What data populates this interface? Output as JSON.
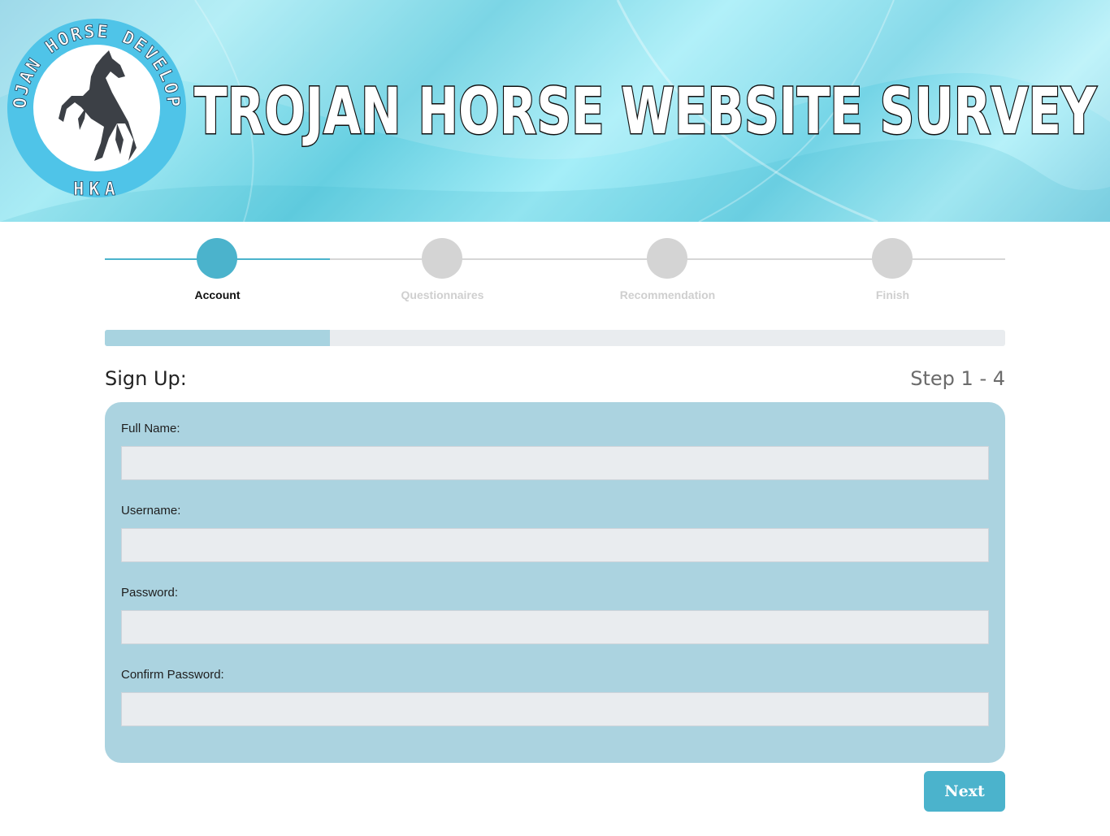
{
  "banner": {
    "title": "TROJAN HORSE WEBSITE SURVEY",
    "logo": {
      "ring_text": "TROJAN HORSE DEVELOPER",
      "bottom_text": "HKA",
      "icon": "rearing-horse-icon"
    }
  },
  "stepper": {
    "steps": [
      {
        "label": "Account",
        "icon": "user-icon",
        "glyph": "",
        "active": true
      },
      {
        "label": "Questionnaires",
        "icon": "list-icon",
        "glyph": "",
        "active": false
      },
      {
        "label": "Recommendation",
        "icon": "star-icon",
        "glyph": "",
        "active": false
      },
      {
        "label": "Finish",
        "icon": "check-icon",
        "glyph": "",
        "active": false
      }
    ]
  },
  "progress": {
    "percent": 25
  },
  "form": {
    "heading": "Sign Up:",
    "step_count": "Step 1 - 4",
    "fields": [
      {
        "label": "Full Name:",
        "value": ""
      },
      {
        "label": "Username:",
        "value": ""
      },
      {
        "label": "Password:",
        "value": ""
      },
      {
        "label": "Confirm Password:",
        "value": ""
      }
    ],
    "next_label": "Next"
  },
  "colors": {
    "accent": "#4bb3cc",
    "card": "#abd3e0",
    "progress_fill": "#a8d3e0",
    "input_bg": "#e9ecef"
  }
}
